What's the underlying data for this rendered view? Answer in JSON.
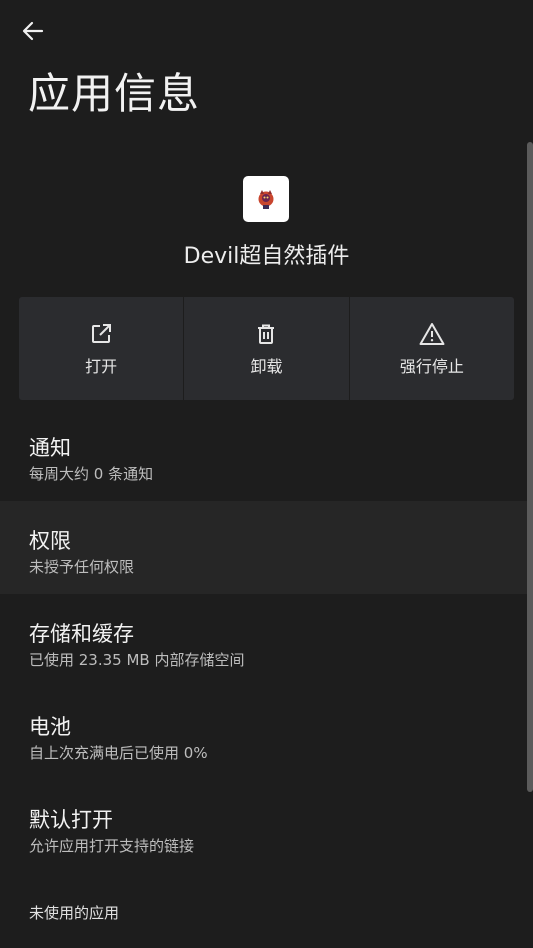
{
  "header": {
    "back_icon": "arrow-back-icon",
    "title": "应用信息"
  },
  "app": {
    "icon": "app-logo-icon",
    "name": "Devil超自然插件"
  },
  "actions": [
    {
      "label": "打开",
      "icon": "open-external-icon"
    },
    {
      "label": "卸载",
      "icon": "trash-icon"
    },
    {
      "label": "强行停止",
      "icon": "warning-icon"
    }
  ],
  "settings": [
    {
      "title": "通知",
      "summary": "每周大约 0 条通知"
    },
    {
      "title": "权限",
      "summary": "未授予任何权限"
    },
    {
      "title": "存储和缓存",
      "summary": "已使用 23.35 MB 内部存储空间"
    },
    {
      "title": "电池",
      "summary": "自上次充满电后已使用 0%"
    },
    {
      "title": "默认打开",
      "summary": "允许应用打开支持的链接"
    }
  ],
  "section": {
    "unused_apps": "未使用的应用"
  },
  "colors": {
    "background": "#1d1d1d",
    "action_background": "#2b2c2f",
    "highlight": "#262626"
  }
}
